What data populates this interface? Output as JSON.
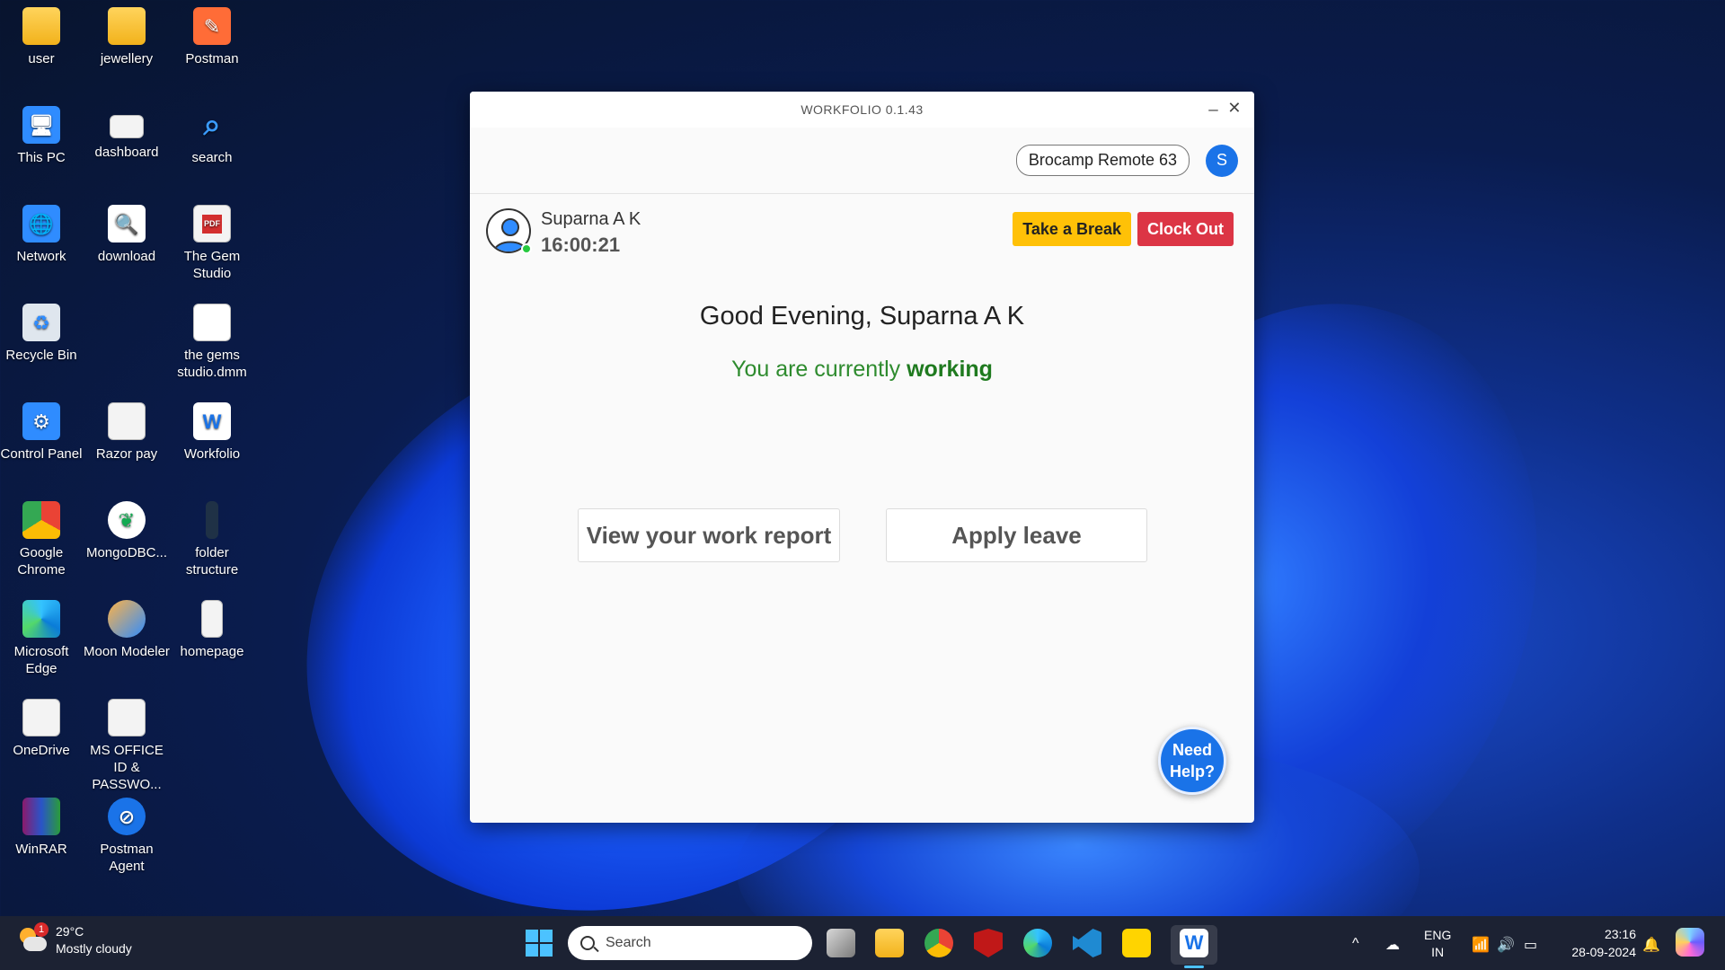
{
  "desktop": {
    "icons": [
      {
        "label": "user"
      },
      {
        "label": "jewellery"
      },
      {
        "label": "Postman"
      },
      {
        "label": "This PC"
      },
      {
        "label": "dashboard"
      },
      {
        "label": "search"
      },
      {
        "label": "Network"
      },
      {
        "label": "download"
      },
      {
        "label": "The Gem Studio"
      },
      {
        "label": "Recycle Bin"
      },
      {
        "label": "the gems studio.dmm"
      },
      {
        "label": "Control Panel"
      },
      {
        "label": "Razor pay"
      },
      {
        "label": "Workfolio"
      },
      {
        "label": "Google Chrome"
      },
      {
        "label": "MongoDBC..."
      },
      {
        "label": "folder structure"
      },
      {
        "label": "Microsoft Edge"
      },
      {
        "label": "Moon Modeler"
      },
      {
        "label": "homepage"
      },
      {
        "label": "OneDrive"
      },
      {
        "label": "MS OFFICE ID & PASSWO..."
      },
      {
        "label": "WinRAR"
      },
      {
        "label": "Postman Agent"
      }
    ],
    "pdf_badge": "PDF"
  },
  "window": {
    "title": "WORKFOLIO 0.1.43",
    "minimize": "_",
    "close": "✕",
    "org_name": "Brocamp Remote 63",
    "avatar_initial": "S",
    "user_name": "Suparna A K",
    "timer": "16:00:21",
    "take_break": "Take a Break",
    "clock_out": "Clock Out",
    "greeting": "Good Evening, Suparna A K",
    "status_prefix": "You are currently ",
    "status_value": "working",
    "view_report": "View your work report",
    "apply_leave": "Apply leave",
    "need_help_line1": "Need",
    "need_help_line2": "Help?"
  },
  "taskbar": {
    "weather_temp": "29°C",
    "weather_desc": "Mostly cloudy",
    "weather_badge": "1",
    "search_placeholder": "Search",
    "lang_line1": "ENG",
    "lang_line2": "IN",
    "time": "23:16",
    "date": "28-09-2024"
  },
  "colors": {
    "accent": "#1a73e8",
    "break_button": "#ffc107",
    "clockout_button": "#dc3545",
    "working_green": "#2e8b2e"
  }
}
